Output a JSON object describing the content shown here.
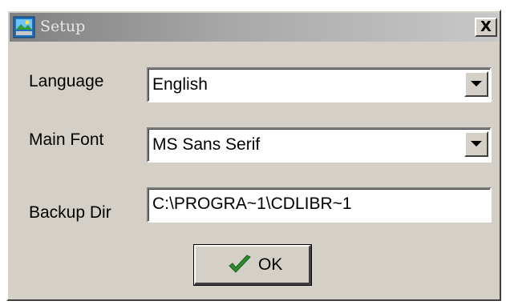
{
  "window": {
    "title": "Setup",
    "close_label": "X",
    "icons": {
      "app": "setup-app-icon",
      "close": "close-icon"
    }
  },
  "form": {
    "language": {
      "label": "Language",
      "value": "English",
      "icon": "chevron-down-icon"
    },
    "main_font": {
      "label": "Main Font",
      "value": "MS Sans Serif",
      "icon": "chevron-down-icon"
    },
    "backup_dir": {
      "label": "Backup Dir",
      "value": "C:\\PROGRA~1\\CDLIBR~1"
    }
  },
  "ok_button": {
    "label": "OK",
    "icon": "checkmark-icon",
    "icon_color": "#2e8b2e"
  }
}
